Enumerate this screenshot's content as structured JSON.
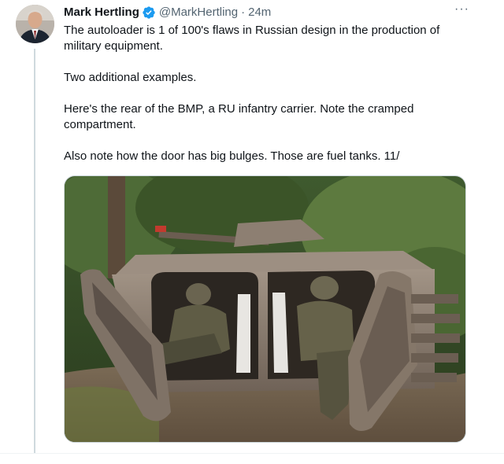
{
  "author": {
    "name": "Mark Hertling",
    "handle": "@MarkHertling",
    "separator": "·",
    "time": "24m"
  },
  "icons": {
    "verified": "verified-badge-icon",
    "more": "more-options-icon"
  },
  "colors": {
    "verified": "#1d9bf0",
    "text": "#0f1419",
    "secondary": "#536471"
  },
  "tweet": {
    "more_label": "···",
    "paragraphs": [
      "The autoloader is 1 of 100's flaws in Russian design in the production of military equipment.",
      "Two additional examples.",
      "Here's the rear of the BMP, a RU infantry carrier.  Note the cramped compartment.",
      "Also note how the door has big bulges. Those are fuel tanks. 11/"
    ]
  }
}
